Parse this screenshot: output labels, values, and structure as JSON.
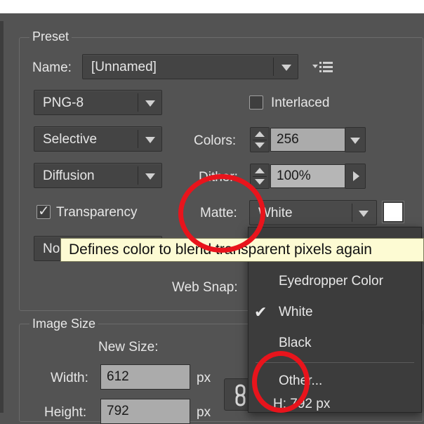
{
  "preset": {
    "group_title": "Preset",
    "name_label": "Name:",
    "name_value": "[Unnamed]",
    "format_value": "PNG-8",
    "interlaced_label": "Interlaced",
    "interlaced_checked": false,
    "reduction_value": "Selective",
    "colors_label": "Colors:",
    "colors_value": "256",
    "dither_algo_value": "Diffusion",
    "dither_label": "Dither:",
    "dither_value": "100%",
    "transparency_label": "Transparency",
    "transparency_checked": true,
    "matte_label": "Matte:",
    "matte_value": "White",
    "matte_swatch_color": "#ffffff",
    "transparency_dither_value": "No",
    "websnap_label": "Web Snap:"
  },
  "tooltip": {
    "text": "Defines color to blend transparent pixels again"
  },
  "matte_menu": {
    "items": [
      {
        "label": "Eyedropper Color",
        "checked": false
      },
      {
        "label": "White",
        "checked": true
      },
      {
        "label": "Black",
        "checked": false
      },
      {
        "label": "Other...",
        "checked": false
      }
    ]
  },
  "image_size": {
    "group_title": "Image Size",
    "new_size_label": "New Size:",
    "width_label": "Width:",
    "width_value": "612",
    "width_unit": "px",
    "height_label": "Height:",
    "height_value": "792",
    "height_unit": "px",
    "original_height_text": "H:  792 px"
  },
  "annotations": {
    "circle_color": "#e8141c"
  },
  "icons": {
    "name_menu": "list-menu-icon",
    "link": "chain-link-icon",
    "checkmark": "checkmark-icon"
  }
}
